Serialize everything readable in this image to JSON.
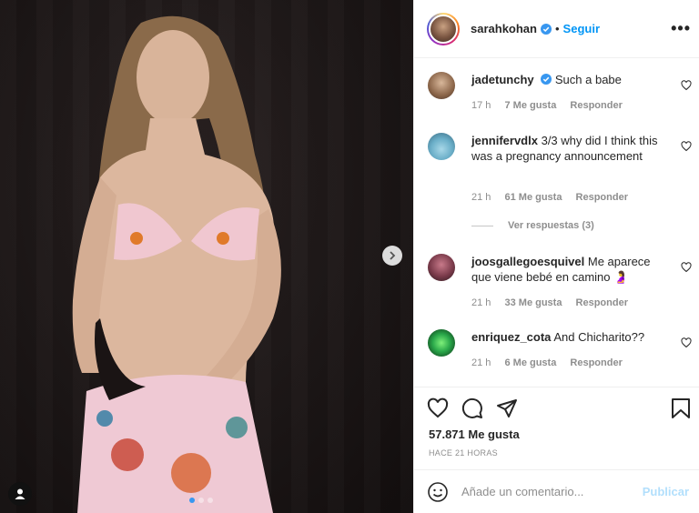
{
  "post": {
    "username": "sarahkohan",
    "follow_label": "Seguir",
    "more_label": "•••",
    "likes": "57.871 Me gusta",
    "time": "HACE 21 HORAS",
    "dot": "•"
  },
  "comments": [
    {
      "user": "jadetunchy",
      "verified": true,
      "text": "Such a babe",
      "time": "17 h",
      "likes": "7 Me gusta",
      "reply": "Responder"
    },
    {
      "user": "jennifervdlx",
      "verified": false,
      "text": "3/3 why did I think this was a pregnancy announcement",
      "time": "21 h",
      "likes": "61 Me gusta",
      "reply": "Responder",
      "view_replies": "Ver respuestas (3)"
    },
    {
      "user": "joosgallegoesquivel",
      "verified": false,
      "text": "Me aparece que viene bebé en camino",
      "emoji": "🤰",
      "time": "21 h",
      "likes": "33 Me gusta",
      "reply": "Responder"
    },
    {
      "user": "enriquez_cota",
      "verified": false,
      "text": "And Chicharito??",
      "time": "21 h",
      "likes": "6 Me gusta",
      "reply": "Responder"
    }
  ],
  "composer": {
    "placeholder": "Añade un comentario...",
    "publish_label": "Publicar"
  },
  "colors": {
    "link_blue": "#0095f6",
    "publish_disabled": "#b2dffc",
    "muted": "#8e8e8e"
  },
  "icons": [
    "heart-icon",
    "comment-icon",
    "share-icon",
    "bookmark-icon",
    "emoji-icon",
    "chevron-right-icon",
    "user-tag-icon",
    "verified-icon",
    "more-icon"
  ]
}
